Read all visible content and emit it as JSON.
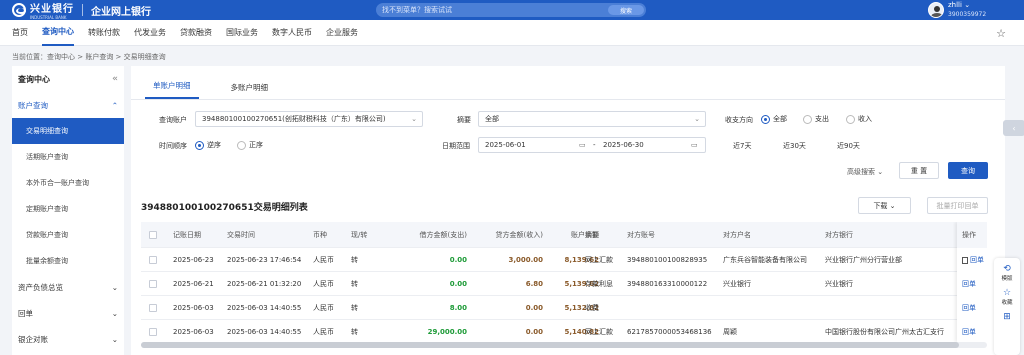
{
  "topbar": {
    "logo_cn": "兴业银行",
    "logo_en": "INDUSTRIAL BANK",
    "title": "企业网上银行",
    "search_placeholder": "找不到菜单？搜索试试",
    "search_button": "搜索",
    "user_name": "zhlli",
    "user_phone": "3900359972"
  },
  "nav": {
    "items": [
      "首页",
      "查询中心",
      "转账付款",
      "代发业务",
      "贷款融资",
      "国际业务",
      "数字人民币",
      "企业服务"
    ],
    "active_index": 1
  },
  "breadcrumb": "当前位置：查询中心 > 账户查询 > 交易明细查询",
  "sidebar": {
    "title": "查询中心",
    "collapse_icon": "«",
    "group_account": "账户查询",
    "items": [
      "交易明细查询",
      "活期账户查询",
      "本外币合一账户查询",
      "定期账户查询",
      "贷款账户查询",
      "批量余额查询"
    ],
    "groups_after": [
      "资产负债总览",
      "回单",
      "银企对账"
    ]
  },
  "tabs": [
    "单账户明细",
    "多账户明细"
  ],
  "filters": {
    "account_label": "查询账户",
    "account_value": "394880100100270651(创拓财税科技（广东）有限公司)",
    "summary_label": "摘要",
    "summary_value": "全部",
    "direction_label": "收支方向",
    "direction_options": [
      "全部",
      "支出",
      "收入"
    ],
    "order_label": "时间顺序",
    "order_options": [
      "逆序",
      "正序"
    ],
    "date_label": "日期范围",
    "date_from": "2025-06-01",
    "date_sep": "-",
    "date_to": "2025-06-30",
    "quick": [
      "近7天",
      "近30天",
      "近90天"
    ],
    "advanced": "高级搜索",
    "reset": "重 置",
    "query": "查询"
  },
  "list": {
    "title": "394880100100270651交易明细列表",
    "download": "下载",
    "batch_print": "批量打印回单",
    "columns": [
      "记账日期",
      "交易时间",
      "币种",
      "现/转",
      "借方金额(支出)",
      "贷方金额(收入)",
      "账户余额",
      "摘要",
      "对方账号",
      "对方户名",
      "对方银行",
      "操作"
    ],
    "rows": [
      {
        "date": "2025-06-23",
        "time": "2025-06-23 17:46:54",
        "cur": "人民币",
        "ct": "转",
        "debit": "0.00",
        "credit": "3,000.00",
        "balance": "8,139.62",
        "summary": "网上汇款",
        "acct": "394880100100828935",
        "name": "广东兵谷智能装备有限公司",
        "bank": "兴业银行广州分行营业部",
        "op": "回单"
      },
      {
        "date": "2025-06-21",
        "time": "2025-06-21 01:32:20",
        "cur": "人民币",
        "ct": "转",
        "debit": "0.00",
        "credit": "6.80",
        "balance": "5,139.62",
        "summary": "存款利息",
        "acct": "394880163310000122",
        "name": "兴业银行",
        "bank": "兴业银行",
        "op": "回单"
      },
      {
        "date": "2025-06-03",
        "time": "2025-06-03 14:40:55",
        "cur": "人民币",
        "ct": "转",
        "debit": "8.00",
        "credit": "0.00",
        "balance": "5,132.82",
        "summary": "收费",
        "acct": "",
        "name": "",
        "bank": "",
        "op": "回单"
      },
      {
        "date": "2025-06-03",
        "time": "2025-06-03 14:40:55",
        "cur": "人民币",
        "ct": "转",
        "debit": "29,000.00",
        "credit": "0.00",
        "balance": "5,140.82",
        "summary": "网上汇款",
        "acct": "6217857000053468136",
        "name": "周颖",
        "bank": "中国银行股份有限公司广州太古汇支行",
        "op": "回单"
      }
    ]
  },
  "float_panel": [
    "模版",
    "收藏"
  ],
  "colors": {
    "brand": "#1f5bc2",
    "credit": "#1e9b38",
    "balance": "#8a5a2a"
  }
}
